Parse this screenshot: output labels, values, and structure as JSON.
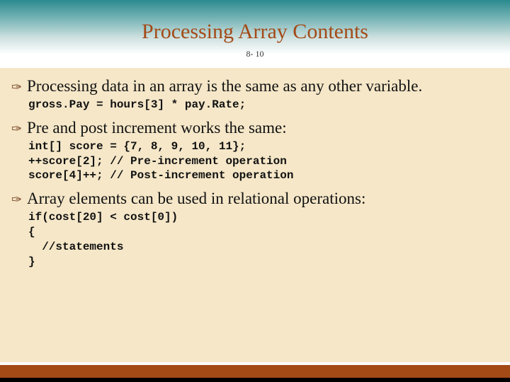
{
  "title": "Processing Array Contents",
  "page": "8-\n10",
  "bullets": {
    "b1": "Processing data in an array is the same as any other variable.",
    "b2": "Pre and post increment works the same:",
    "b3": "Array elements can be used in relational operations:"
  },
  "code": {
    "c1": "gross.Pay = hours[3] * pay.Rate;",
    "c2": "int[] score = {7, 8, 9, 10, 11};\n++score[2]; // Pre-increment operation\nscore[4]++; // Post-increment operation",
    "c3": "if(cost[20] < cost[0])\n{\n  //statements\n}"
  }
}
